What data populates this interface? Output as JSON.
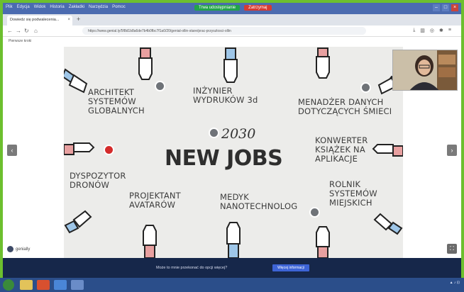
{
  "titlebar": {
    "menu": [
      "Plik",
      "Edycja",
      "Widok",
      "Historia",
      "Zakładki",
      "Narzędzia",
      "Pomoc"
    ],
    "share_status": "Trwa udostępnianie",
    "share_stop": "Zatrzymaj"
  },
  "tab": {
    "title": "Dowiedz się podwalecenia..."
  },
  "address_bar": {
    "url": "https://www.genial.ly/5f8d1b8a6de7b4b0fbc7f1a0/20/genial-ollin-stare/prac-przyszlosci-ollin"
  },
  "bookmarks": {
    "label": "Pierwsze kroki"
  },
  "slide": {
    "year": "2030",
    "title": "NEW JOBS",
    "jobs": [
      "ARCHITEKT\nSYSTEMÓW\nGLOBALNYCH",
      "INŻYNIER\nWYDRUKÓW 3d",
      "MENADŻER DANYCH\nDOTYCZĄCYCH ŚMIECI",
      "KONWERTER\nKSIĄŻEK NA\nAPLIKACJE",
      "DYSPOZYTOR\nDRONÓW",
      "PROJEKTANT\nAVATARÓW",
      "MEDYK\nNANOTECHNOLOG",
      "ROLNIK\nSYSTEMÓW\nMIEJSKICH"
    ]
  },
  "viewer": {
    "logo": "genially"
  },
  "notification": {
    "text": "Może to mnie przekonać do opcji więcej?",
    "button": "Więcej informacji"
  },
  "colors": {
    "accent": "#d42b2b",
    "chrome": "#4b6bb0",
    "notify_bg": "#16274a"
  }
}
